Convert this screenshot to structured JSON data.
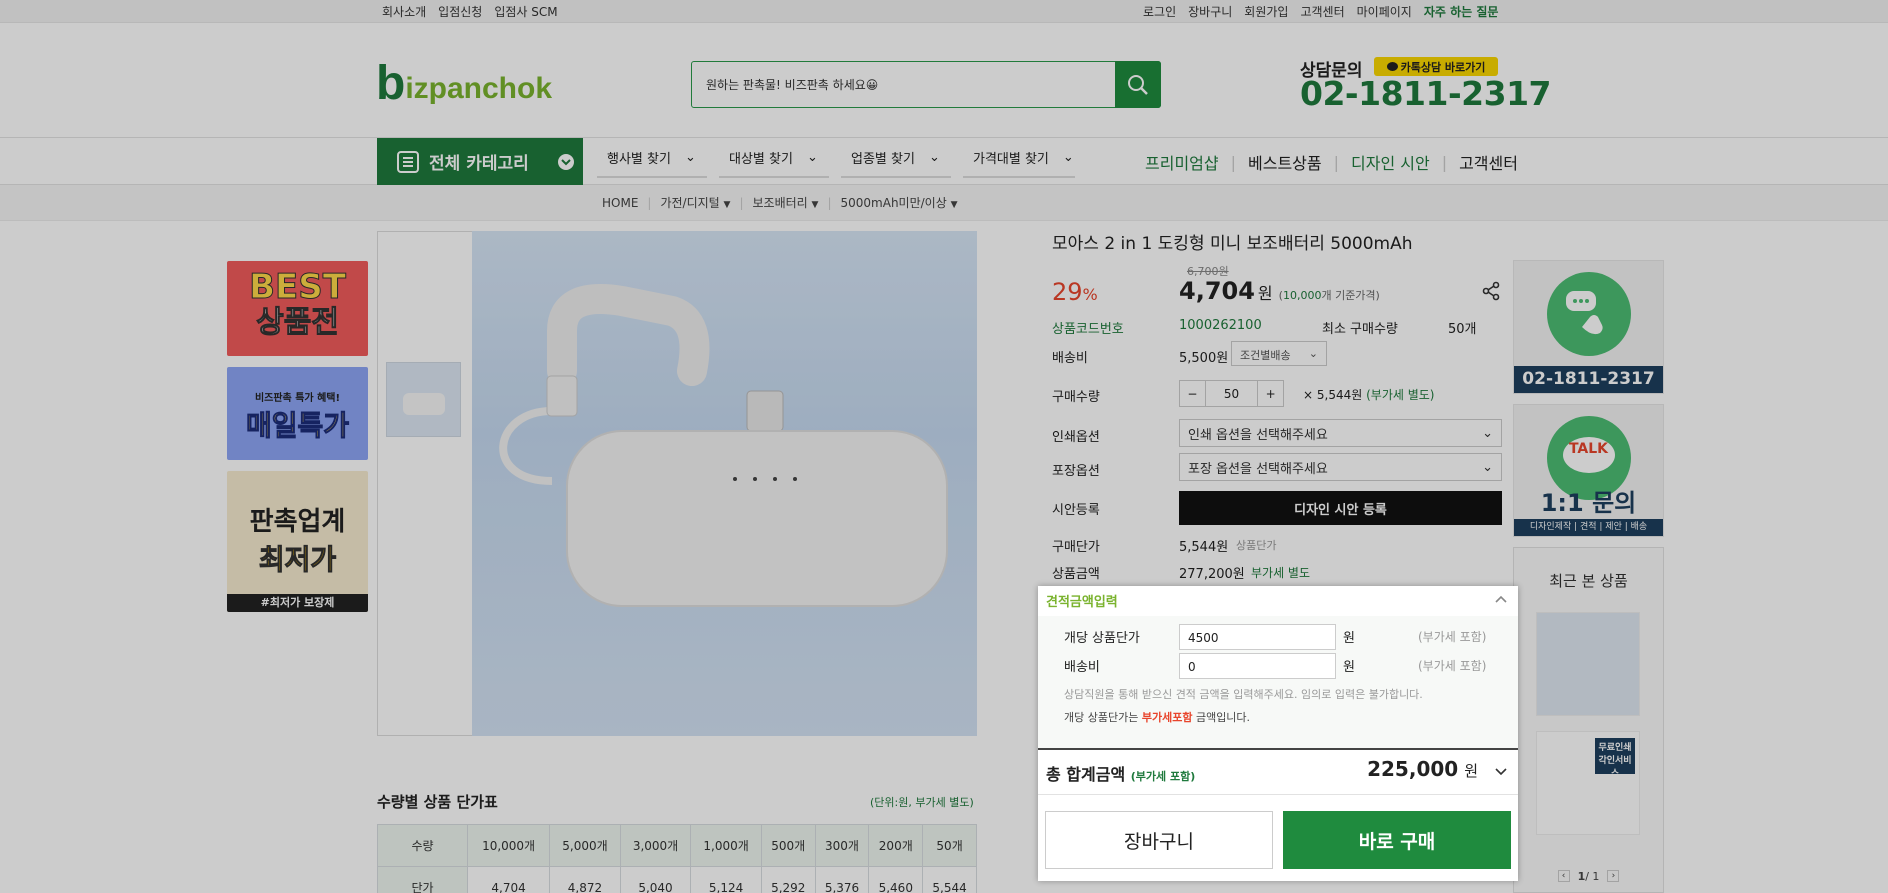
{
  "topbar": {
    "left": [
      "회사소개",
      "입점신청",
      "입점사 SCM"
    ],
    "right": [
      "로그인",
      "장바구니",
      "회원가입",
      "고객센터",
      "마이페이지"
    ],
    "faq": "자주 하는 질문"
  },
  "header": {
    "logo_b": "b",
    "logo_rest": "izpanchok",
    "search_placeholder": "원하는 판촉물! 비즈판촉 하세요😀",
    "contact_label": "상담문의",
    "kakao_label": "카톡상담 바로가기",
    "phone": "02-1811-2317"
  },
  "nav": {
    "all_category": "전체 카테고리",
    "items": [
      "행사별 찾기",
      "대상별 찾기",
      "업종별 찾기",
      "가격대별 찾기"
    ],
    "right": [
      "프리미엄샵",
      "베스트상품",
      "디자인 시안",
      "고객센터"
    ]
  },
  "breadcrumb": [
    "HOME",
    "가전/디지털",
    "보조배터리",
    "5000mAh미만/이상"
  ],
  "left_banners": {
    "best_line1": "BEST",
    "best_line2": "상품전",
    "daily_small": "비즈판촉 특가 혜택!",
    "daily_big": "매일특가",
    "lowest_line1": "판촉업계",
    "lowest_line2": "최저가",
    "lowest_tag": "#최저가 보장제"
  },
  "product": {
    "title": "모아스 2 in 1 도킹형 미니 보조배터리 5000mAh",
    "original_price": "6,700원",
    "discount": "29",
    "discount_unit": "%",
    "price": "4,704",
    "price_unit": "원",
    "price_note_qty": "10,000",
    "price_note_rest": "개 기준가격)",
    "code_label": "상품코드번호",
    "code": "1000262100",
    "min_qty_label": "최소 구매수량",
    "min_qty": "50개",
    "shipping_label": "배송비",
    "shipping": "5,500원",
    "shipping_option": "조건별배송",
    "qty_label": "구매수량",
    "qty": "50",
    "qty_minus": "−",
    "qty_plus": "+",
    "qty_price": "× 5,544원",
    "qty_vat": "(부가세 별도)",
    "print_label": "인쇄옵션",
    "print_placeholder": "인쇄 옵션을 선택해주세요",
    "pack_label": "포장옵션",
    "pack_placeholder": "포장 옵션을 선택해주세요",
    "design_label": "시안등록",
    "design_button": "디자인 시안 등록",
    "unit_price_label": "구매단가",
    "unit_price": "5,544원",
    "unit_price_note": "상품단가",
    "amount_label": "상품금액",
    "amount": "277,200원",
    "amount_note": "부가세 별도"
  },
  "estimate": {
    "title": "견적금액입력",
    "unit_label": "개당 상품단가",
    "unit_value": "4500",
    "won": "원",
    "vat": "(부가세 포함)",
    "ship_label": "배송비",
    "ship_value": "0",
    "notice1": "상담직원을 통해 받으신 견적 금액을 입력해주세요. 임의로 입력은 불가합니다.",
    "notice2_pre": "개당 상품단가는 ",
    "notice2_red": "부가세포함",
    "notice2_post": " 금액입니다.",
    "total_label": "총 합계금액",
    "total_vat": "(부가세 포함)",
    "total": "225,000",
    "total_unit": "원",
    "cart_button": "장바구니",
    "buy_button": "바로 구매"
  },
  "right_side": {
    "call_phone": "02-1811-2317",
    "talk": "TALK",
    "inquiry": "1:1 문의",
    "inquiry_sub": "디자인제작 | 견적 | 제안 | 배송",
    "recent_title": "최근 본 상품",
    "free_print_1": "무료인쇄",
    "free_print_2": "각인서비스",
    "page": "1",
    "page_total": "/ 1"
  },
  "price_table": {
    "title": "수량별 상품 단가표",
    "unit_note": "(단위:원, 부가세 별도)",
    "headers": [
      "수량",
      "10,000개",
      "5,000개",
      "3,000개",
      "1,000개",
      "500개",
      "300개",
      "200개",
      "50개"
    ],
    "row": [
      "단가",
      "4,704",
      "4,872",
      "5,040",
      "5,124",
      "5,292",
      "5,376",
      "5,460",
      "5,544"
    ]
  },
  "colors": {
    "brand_green": "#1f7a3d",
    "discount_red": "#e8452c",
    "kakao_yellow": "#fbd700"
  }
}
